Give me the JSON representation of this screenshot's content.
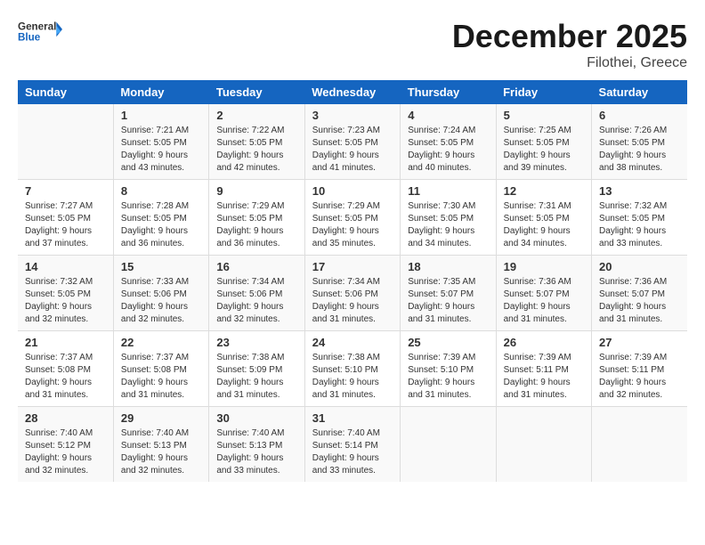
{
  "header": {
    "logo_general": "General",
    "logo_blue": "Blue",
    "month_year": "December 2025",
    "location": "Filothei, Greece"
  },
  "days_of_week": [
    "Sunday",
    "Monday",
    "Tuesday",
    "Wednesday",
    "Thursday",
    "Friday",
    "Saturday"
  ],
  "weeks": [
    [
      {
        "day": "",
        "info": ""
      },
      {
        "day": "1",
        "info": "Sunrise: 7:21 AM\nSunset: 5:05 PM\nDaylight: 9 hours\nand 43 minutes."
      },
      {
        "day": "2",
        "info": "Sunrise: 7:22 AM\nSunset: 5:05 PM\nDaylight: 9 hours\nand 42 minutes."
      },
      {
        "day": "3",
        "info": "Sunrise: 7:23 AM\nSunset: 5:05 PM\nDaylight: 9 hours\nand 41 minutes."
      },
      {
        "day": "4",
        "info": "Sunrise: 7:24 AM\nSunset: 5:05 PM\nDaylight: 9 hours\nand 40 minutes."
      },
      {
        "day": "5",
        "info": "Sunrise: 7:25 AM\nSunset: 5:05 PM\nDaylight: 9 hours\nand 39 minutes."
      },
      {
        "day": "6",
        "info": "Sunrise: 7:26 AM\nSunset: 5:05 PM\nDaylight: 9 hours\nand 38 minutes."
      }
    ],
    [
      {
        "day": "7",
        "info": "Sunrise: 7:27 AM\nSunset: 5:05 PM\nDaylight: 9 hours\nand 37 minutes."
      },
      {
        "day": "8",
        "info": "Sunrise: 7:28 AM\nSunset: 5:05 PM\nDaylight: 9 hours\nand 36 minutes."
      },
      {
        "day": "9",
        "info": "Sunrise: 7:29 AM\nSunset: 5:05 PM\nDaylight: 9 hours\nand 36 minutes."
      },
      {
        "day": "10",
        "info": "Sunrise: 7:29 AM\nSunset: 5:05 PM\nDaylight: 9 hours\nand 35 minutes."
      },
      {
        "day": "11",
        "info": "Sunrise: 7:30 AM\nSunset: 5:05 PM\nDaylight: 9 hours\nand 34 minutes."
      },
      {
        "day": "12",
        "info": "Sunrise: 7:31 AM\nSunset: 5:05 PM\nDaylight: 9 hours\nand 34 minutes."
      },
      {
        "day": "13",
        "info": "Sunrise: 7:32 AM\nSunset: 5:05 PM\nDaylight: 9 hours\nand 33 minutes."
      }
    ],
    [
      {
        "day": "14",
        "info": "Sunrise: 7:32 AM\nSunset: 5:05 PM\nDaylight: 9 hours\nand 32 minutes."
      },
      {
        "day": "15",
        "info": "Sunrise: 7:33 AM\nSunset: 5:06 PM\nDaylight: 9 hours\nand 32 minutes."
      },
      {
        "day": "16",
        "info": "Sunrise: 7:34 AM\nSunset: 5:06 PM\nDaylight: 9 hours\nand 32 minutes."
      },
      {
        "day": "17",
        "info": "Sunrise: 7:34 AM\nSunset: 5:06 PM\nDaylight: 9 hours\nand 31 minutes."
      },
      {
        "day": "18",
        "info": "Sunrise: 7:35 AM\nSunset: 5:07 PM\nDaylight: 9 hours\nand 31 minutes."
      },
      {
        "day": "19",
        "info": "Sunrise: 7:36 AM\nSunset: 5:07 PM\nDaylight: 9 hours\nand 31 minutes."
      },
      {
        "day": "20",
        "info": "Sunrise: 7:36 AM\nSunset: 5:07 PM\nDaylight: 9 hours\nand 31 minutes."
      }
    ],
    [
      {
        "day": "21",
        "info": "Sunrise: 7:37 AM\nSunset: 5:08 PM\nDaylight: 9 hours\nand 31 minutes."
      },
      {
        "day": "22",
        "info": "Sunrise: 7:37 AM\nSunset: 5:08 PM\nDaylight: 9 hours\nand 31 minutes."
      },
      {
        "day": "23",
        "info": "Sunrise: 7:38 AM\nSunset: 5:09 PM\nDaylight: 9 hours\nand 31 minutes."
      },
      {
        "day": "24",
        "info": "Sunrise: 7:38 AM\nSunset: 5:10 PM\nDaylight: 9 hours\nand 31 minutes."
      },
      {
        "day": "25",
        "info": "Sunrise: 7:39 AM\nSunset: 5:10 PM\nDaylight: 9 hours\nand 31 minutes."
      },
      {
        "day": "26",
        "info": "Sunrise: 7:39 AM\nSunset: 5:11 PM\nDaylight: 9 hours\nand 31 minutes."
      },
      {
        "day": "27",
        "info": "Sunrise: 7:39 AM\nSunset: 5:11 PM\nDaylight: 9 hours\nand 32 minutes."
      }
    ],
    [
      {
        "day": "28",
        "info": "Sunrise: 7:40 AM\nSunset: 5:12 PM\nDaylight: 9 hours\nand 32 minutes."
      },
      {
        "day": "29",
        "info": "Sunrise: 7:40 AM\nSunset: 5:13 PM\nDaylight: 9 hours\nand 32 minutes."
      },
      {
        "day": "30",
        "info": "Sunrise: 7:40 AM\nSunset: 5:13 PM\nDaylight: 9 hours\nand 33 minutes."
      },
      {
        "day": "31",
        "info": "Sunrise: 7:40 AM\nSunset: 5:14 PM\nDaylight: 9 hours\nand 33 minutes."
      },
      {
        "day": "",
        "info": ""
      },
      {
        "day": "",
        "info": ""
      },
      {
        "day": "",
        "info": ""
      }
    ]
  ]
}
